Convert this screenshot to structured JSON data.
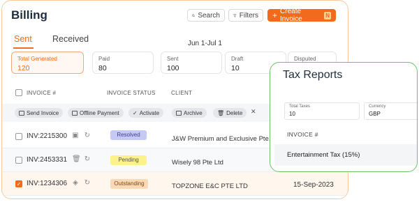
{
  "billing": {
    "title": "Billing",
    "search_label": "Search",
    "filters_label": "Filters",
    "create_label": "Create Invoice",
    "create_badge": "N",
    "tabs": [
      {
        "label": "Sent"
      },
      {
        "label": "Received"
      }
    ],
    "date_range": "Jun 1-Jul 1",
    "stats": [
      {
        "label": "Total Generated",
        "value": "120"
      },
      {
        "label": "Paid",
        "value": "80"
      },
      {
        "label": "Sent",
        "value": "100"
      },
      {
        "label": "Draft",
        "value": "10"
      },
      {
        "label": "Disputed",
        "value": ""
      }
    ],
    "columns": {
      "invoice": "INVOICE #",
      "status": "INVOICE STATUS",
      "client": "CLIENT"
    },
    "bulk_actions": [
      "Send Invoice",
      "Offline Payment",
      "Activate",
      "Archive",
      "Delete"
    ],
    "rows": [
      {
        "invoice": "INV:2215300",
        "status": "Resolved",
        "client": "J&W Premium and Exclusive Pte. Lt",
        "date": "",
        "checked": false
      },
      {
        "invoice": "INV:2453331",
        "status": "Pending",
        "client": "Wisely 98 Pte Ltd",
        "date": "",
        "checked": false
      },
      {
        "invoice": "INV:1234306",
        "status": "Outstanding",
        "client": "TOPZONE E&C PTE LTD",
        "date": "15-Sep-2023",
        "checked": true
      }
    ]
  },
  "tax": {
    "title": "Tax Reports",
    "total_taxes_label": "Total Taxes",
    "total_taxes_value": "10",
    "currency_label": "Currency",
    "currency_value": "GBP",
    "column_invoice": "INVOICE #",
    "rows": [
      {
        "name": "Entertainment Tax (15%)"
      }
    ]
  },
  "colors": {
    "accent": "#f26a1b",
    "tax_border": "#6fbf73"
  }
}
